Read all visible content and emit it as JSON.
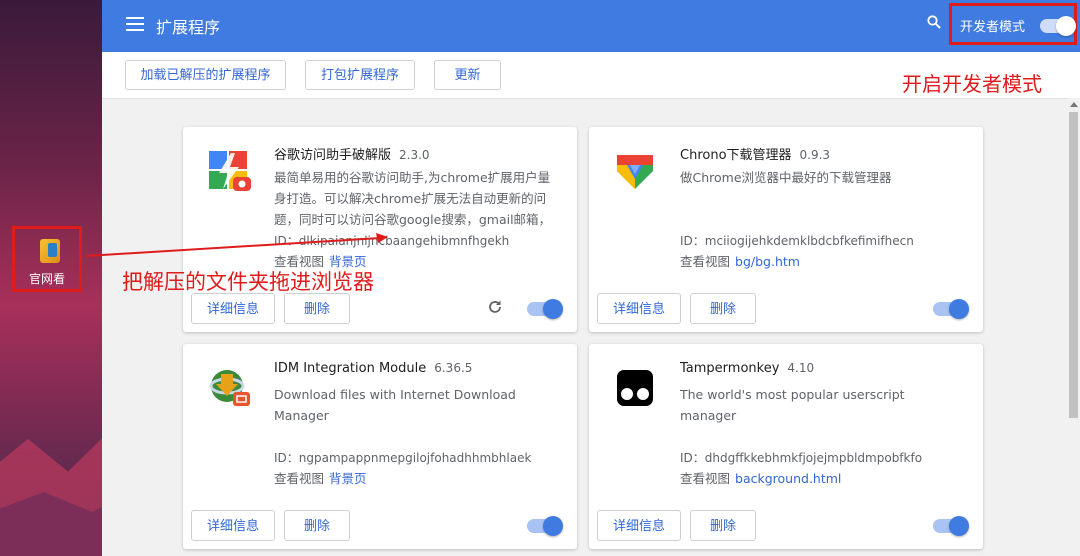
{
  "desktop": {
    "icon_label": "官网看"
  },
  "header": {
    "title": "扩展程序",
    "dev_mode_label": "开发者模式",
    "dev_mode_on": true
  },
  "toolbar": {
    "load_unpacked": "加载已解压的扩展程序",
    "pack": "打包扩展程序",
    "update": "更新"
  },
  "annotations": {
    "dev_mode": "开启开发者模式",
    "drag": "把解压的文件夹拖进浏览器"
  },
  "colors": {
    "accent": "#3f7be0",
    "link": "#3367d6",
    "annotation": "#e01b1b"
  },
  "extensions": [
    {
      "name": "谷歌访问助手破解版",
      "version": "2.3.0",
      "description": "最简单易用的谷歌访问助手,为chrome扩展用户量身打造。可以解决chrome扩展无法自动更新的问题，同时可以访问谷歌google搜索，gmail邮箱，",
      "id": "ID：dlkipaianjnljncbaangehibmnfhgekh",
      "view_label": "查看视图",
      "view_link": "背景页",
      "details": "详细信息",
      "remove": "删除",
      "enabled": true,
      "icon": "google-access-helper-icon"
    },
    {
      "name": "Chrono下载管理器",
      "version": "0.9.3",
      "description": "做Chrome浏览器中最好的下载管理器",
      "id": "ID：mciiogijehkdemklbdcbfkefimifhecn",
      "view_label": "查看视图",
      "view_link": "bg/bg.htm",
      "details": "详细信息",
      "remove": "删除",
      "enabled": true,
      "icon": "chrono-download-icon"
    },
    {
      "name": "IDM Integration Module",
      "version": "6.36.5",
      "description": "Download files with Internet Download Manager",
      "id": "ID：ngpampappnmepgilojfohadhhmbhlaek",
      "view_label": "查看视图",
      "view_link": "背景页",
      "details": "详细信息",
      "remove": "删除",
      "enabled": true,
      "icon": "idm-icon"
    },
    {
      "name": "Tampermonkey",
      "version": "4.10",
      "description": "The world's most popular userscript manager",
      "id": "ID：dhdgffkkebhmkfjojejmpbldmpobfkfo",
      "view_label": "查看视图",
      "view_link": "background.html",
      "details": "详细信息",
      "remove": "删除",
      "enabled": true,
      "icon": "tampermonkey-icon"
    }
  ]
}
